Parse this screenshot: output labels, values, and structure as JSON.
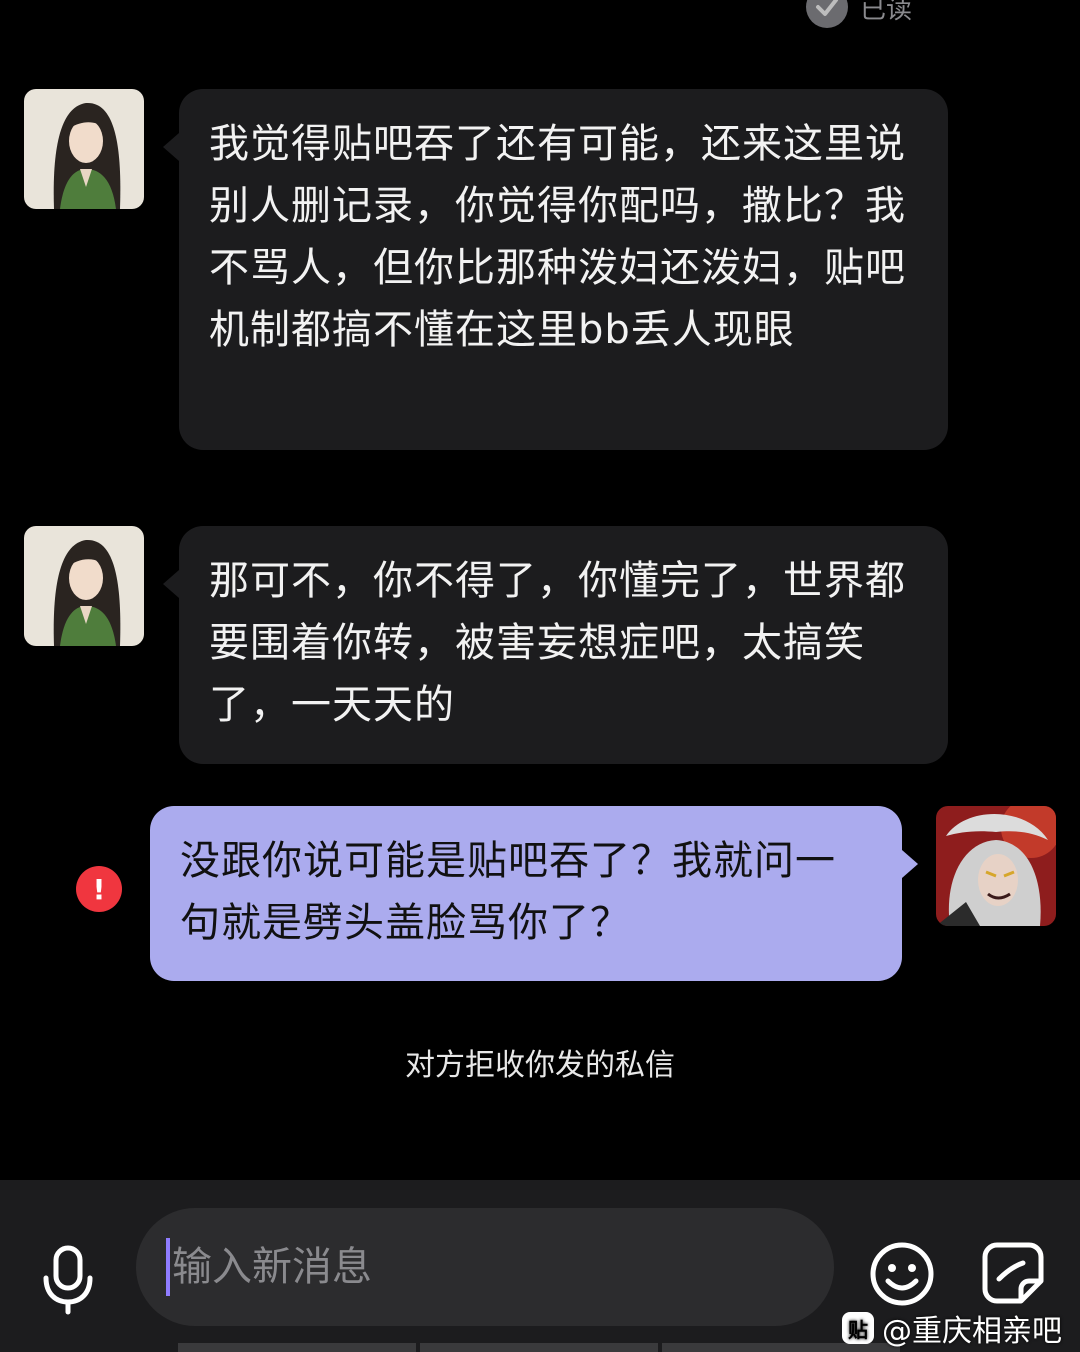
{
  "read_status": "已读",
  "messages": [
    {
      "direction": "incoming",
      "text": "我觉得贴吧吞了还有可能，还来这里说别人删记录，你觉得你配吗，撒比？我不骂人，但你比那种泼妇还泼妇，贴吧机制都搞不懂在这里bb丢人现眼"
    },
    {
      "direction": "incoming",
      "text": "那可不，你不得了，你懂完了，世界都要围着你转，被害妄想症吧，太搞笑了，一天天的"
    },
    {
      "direction": "outgoing",
      "text": "没跟你说可能是贴吧吞了？我就问一句就是劈头盖脸骂你了？",
      "status": "failed"
    }
  ],
  "system_note": "对方拒收你发的私信",
  "input": {
    "placeholder": "输入新消息",
    "value": ""
  },
  "icons": [
    "check-icon",
    "error-icon",
    "microphone-icon",
    "emoji-icon",
    "sticker-icon"
  ],
  "watermark": {
    "logo": "贴",
    "text": "@重庆相亲吧"
  },
  "colors": {
    "background": "#000000",
    "incoming_bubble": "#1c1c1e",
    "outgoing_bubble": "#ababee",
    "error": "#f0363f",
    "caret": "#8f7cff"
  }
}
